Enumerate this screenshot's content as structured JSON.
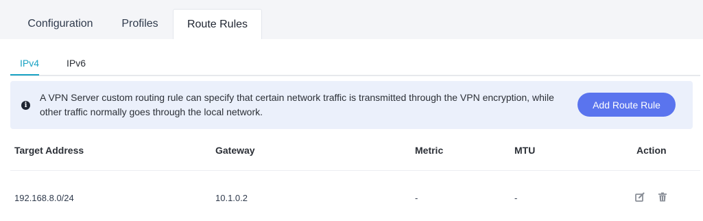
{
  "tabs": [
    "Configuration",
    "Profiles",
    "Route Rules"
  ],
  "active_tab": "Route Rules",
  "subtabs": [
    "IPv4",
    "IPv6"
  ],
  "active_subtab": "IPv4",
  "notice": {
    "text": "A VPN Server custom routing rule can specify that certain network traffic is transmitted through the VPN encryption, while other traffic normally goes through the local network.",
    "add_button": "Add Route Rule"
  },
  "table": {
    "headers": [
      "Target Address",
      "Gateway",
      "Metric",
      "MTU",
      "Action"
    ],
    "rows": [
      {
        "target": "192.168.8.0/24",
        "gateway": "10.1.0.2",
        "metric": "-",
        "mtu": "-"
      }
    ]
  },
  "colors": {
    "accent": "#1aa3c4",
    "button": "#5a74ee",
    "notice_bg": "#ebf0fb"
  },
  "icons": {
    "info": "info-icon",
    "edit": "edit-icon",
    "delete": "trash-icon"
  }
}
